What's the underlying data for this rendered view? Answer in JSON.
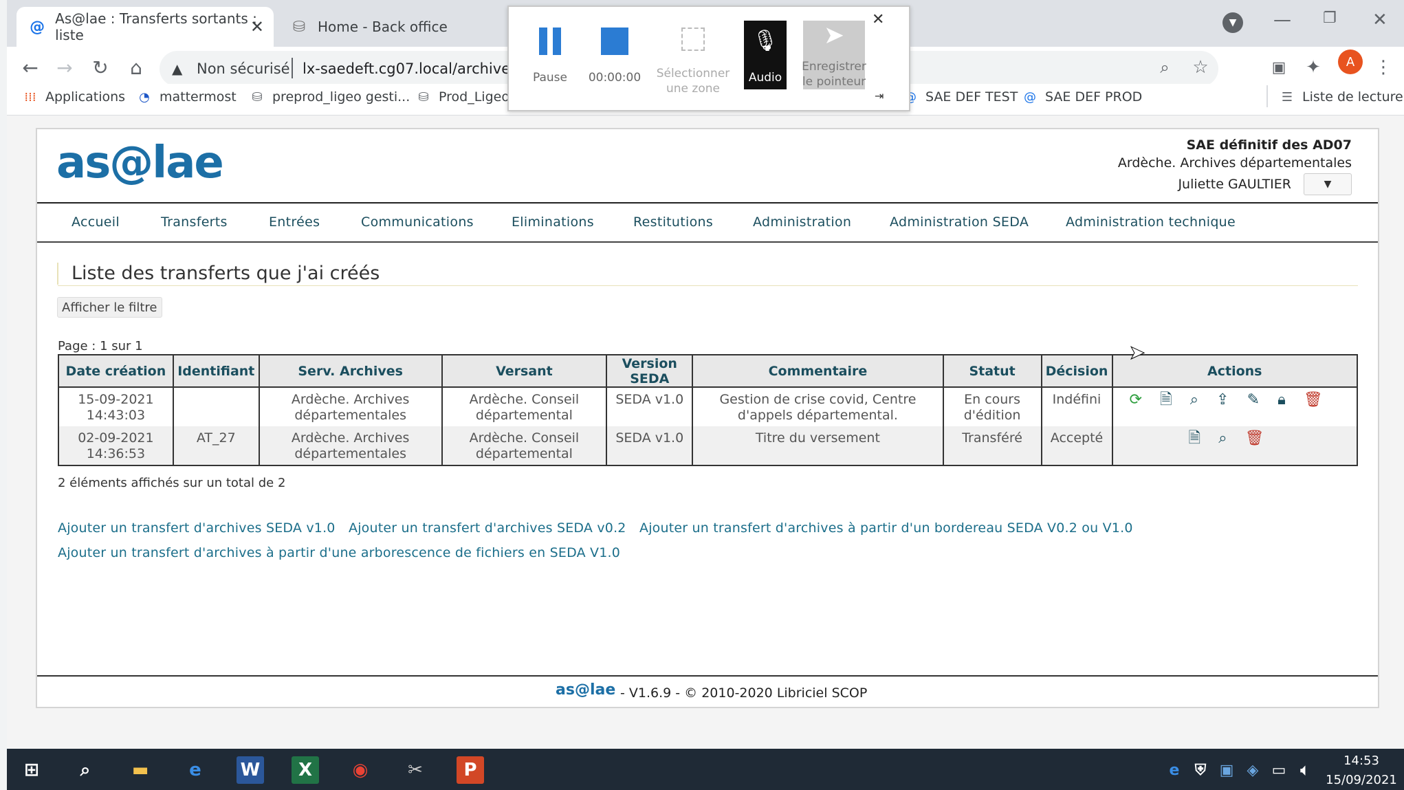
{
  "browser": {
    "tabs": [
      {
        "title": "As@lae : Transferts sortants : liste",
        "active": true
      },
      {
        "title": "Home - Back office",
        "active": false
      }
    ],
    "security_label": "Non sécurisé",
    "url": "lx-saedeft.cg07.local/archivetr",
    "profile_initial": "A",
    "bookmarks": [
      "Applications",
      "mattermost",
      "preprod_ligeo gesti...",
      "Prod_Ligeo",
      "SAE DEF TEST",
      "SAE DEF PROD"
    ],
    "reading_list": "Liste de lecture"
  },
  "recorder": {
    "pause_label": "Pause",
    "timer": "00:00:00",
    "select_zone_label": "Sélectionner une zone",
    "audio_label": "Audio",
    "pointer_label": "Enregistrer le pointeur"
  },
  "app": {
    "logo_text": "as@lae",
    "org_title": "SAE définitif des AD07",
    "org_subtitle": "Ardèche. Archives départementales",
    "user_name": "Juliette GAULTIER",
    "nav": [
      "Accueil",
      "Transferts",
      "Entrées",
      "Communications",
      "Eliminations",
      "Restitutions",
      "Administration",
      "Administration SEDA",
      "Administration technique"
    ],
    "page_title": "Liste des transferts que j'ai créés",
    "filter_button": "Afficher le filtre",
    "pagination": "Page : 1 sur 1",
    "table": {
      "headers": [
        "Date création",
        "Identifiant",
        "Serv. Archives",
        "Versant",
        "Version SEDA",
        "Commentaire",
        "Statut",
        "Décision",
        "Actions"
      ],
      "rows": [
        {
          "date": "15-09-2021 14:43:03",
          "id": "",
          "service": "Ardèche. Archives départementales",
          "versant": "Ardèche. Conseil départemental",
          "seda": "SEDA v1.0",
          "comment": "Gestion de crise covid, Centre d'appels départemental.",
          "status": "En cours d'édition",
          "decision": "Indéfini"
        },
        {
          "date": "02-09-2021 14:36:53",
          "id": "AT_27",
          "service": "Ardèche. Archives départementales",
          "versant": "Ardèche. Conseil départemental",
          "seda": "SEDA v1.0",
          "comment": "Titre du versement",
          "status": "Transféré",
          "decision": "Accepté"
        }
      ]
    },
    "count_text": "2 éléments affichés sur un total de 2",
    "links": [
      "Ajouter un transfert d'archives SEDA v1.0",
      "Ajouter un transfert d'archives SEDA v0.2",
      "Ajouter un transfert d'archives à partir d'un bordereau SEDA V0.2 ou V1.0",
      "Ajouter un transfert d'archives à partir d'une arborescence de fichiers en SEDA V1.0"
    ],
    "footer_logo": "as@lae",
    "footer_text": "- V1.6.9 - © 2010-2020 Libriciel SCOP"
  },
  "taskbar": {
    "time": "14:53",
    "date": "15/09/2021"
  },
  "colors": {
    "accent": "#1b4e5e",
    "link": "#1b6e8a",
    "delete": "#c0392b",
    "refresh": "#2e9e3e"
  }
}
